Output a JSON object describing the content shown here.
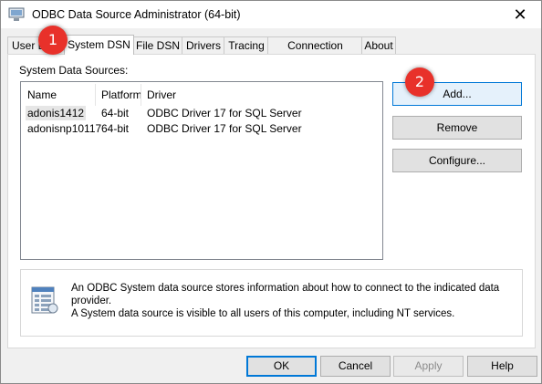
{
  "window": {
    "title": "ODBC Data Source Administrator (64-bit)",
    "close_glyph": "✕"
  },
  "tabs": [
    {
      "label": "User DSN"
    },
    {
      "label": "System DSN"
    },
    {
      "label": "File DSN"
    },
    {
      "label": "Drivers"
    },
    {
      "label": "Tracing"
    },
    {
      "label": "Connection Pooling"
    },
    {
      "label": "About"
    }
  ],
  "active_tab": "System DSN",
  "sources": {
    "label": "System Data Sources:",
    "columns": [
      "Name",
      "Platform",
      "Driver"
    ],
    "rows": [
      {
        "name": "adonis1412",
        "platform": "64-bit",
        "driver": "ODBC Driver 17 for SQL Server"
      },
      {
        "name": "adonisnp10117",
        "platform": "64-bit",
        "driver": "ODBC Driver 17 for SQL Server"
      }
    ]
  },
  "actions": {
    "add": "Add...",
    "remove": "Remove",
    "configure": "Configure..."
  },
  "info": {
    "line1": "An ODBC System data source stores information about how to connect to the indicated data provider.",
    "line2": "A System data source is visible to all users of this computer, including NT services."
  },
  "footer": {
    "ok": "OK",
    "cancel": "Cancel",
    "apply": "Apply",
    "help": "Help"
  },
  "badges": {
    "one": "1",
    "two": "2"
  },
  "colors": {
    "accent": "#0078d7",
    "badge": "#e8312a"
  }
}
